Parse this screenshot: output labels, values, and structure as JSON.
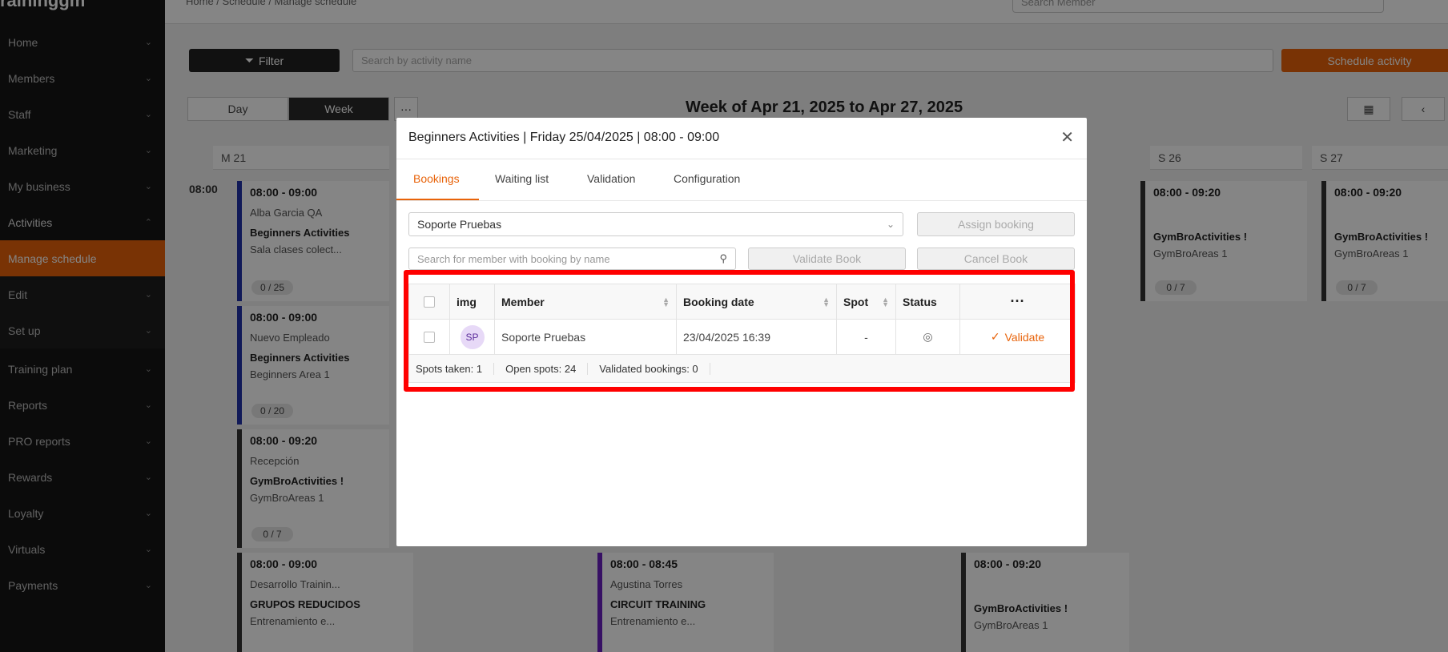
{
  "sidebar": {
    "logo": "raininggm",
    "items": [
      {
        "label": "Home",
        "chev": "⌄"
      },
      {
        "label": "Members",
        "chev": "⌄"
      },
      {
        "label": "Staff",
        "chev": "⌄"
      },
      {
        "label": "Marketing",
        "chev": "⌄"
      },
      {
        "label": "My business",
        "chev": "⌄"
      },
      {
        "label": "Activities",
        "chev": "⌃"
      },
      {
        "label": "Manage schedule",
        "chev": ""
      },
      {
        "label": "Edit",
        "chev": "⌄"
      },
      {
        "label": "Set up",
        "chev": "⌄"
      },
      {
        "label": "Training plan",
        "chev": "⌄"
      },
      {
        "label": "Reports",
        "chev": "⌄"
      },
      {
        "label": "PRO reports",
        "chev": "⌄"
      },
      {
        "label": "Rewards",
        "chev": "⌄"
      },
      {
        "label": "Loyalty",
        "chev": "⌄"
      },
      {
        "label": "Virtuals",
        "chev": "⌄"
      },
      {
        "label": "Payments",
        "chev": "⌄"
      }
    ]
  },
  "header": {
    "breadcrumb": "Home  /  Schedule  /  Manage schedule",
    "search_placeholder": "Search Member"
  },
  "toolbar": {
    "filter_label": "Filter",
    "search_placeholder": "Search by activity name",
    "schedule_label": "Schedule activity",
    "day_label": "Day",
    "week_label": "Week",
    "week_title": "Week of Apr 21, 2025 to Apr 27, 2025"
  },
  "calendar": {
    "columns": [
      "M 21",
      "S 26",
      "S 27"
    ],
    "time": "08:00",
    "cards": [
      {
        "time": "08:00 - 09:00",
        "person": "Alba Garcia QA",
        "name": "Beginners Activities",
        "area": "Sala clases colect...",
        "count": "0 / 25"
      },
      {
        "time": "08:00 - 09:00",
        "person": "Nuevo Empleado",
        "name": "Beginners Activities",
        "area": "Beginners Area 1",
        "count": "0 / 20"
      },
      {
        "time": "08:00 - 09:20",
        "person": "Recepción",
        "name": "GymBroActivities !",
        "area": "GymBroAreas 1",
        "count": "0 / 7"
      },
      {
        "time": "08:00 - 09:00",
        "person": "Desarrollo Trainin...",
        "name": "GRUPOS REDUCIDOS",
        "area": "Entrenamiento e...",
        "count": ""
      },
      {
        "time": "08:00 - 08:45",
        "person": "Agustina Torres",
        "name": "CIRCUIT TRAINING",
        "area": "Entrenamiento e...",
        "count": ""
      },
      {
        "time": "08:00 - 09:20",
        "person": "",
        "name": "GymBroActivities !",
        "area": "GymBroAreas 1",
        "count": ""
      },
      {
        "time": "08:00 - 09:20",
        "person": "",
        "name": "GymBroActivities !",
        "area": "GymBroAreas 1",
        "count": "0 / 7"
      },
      {
        "time": "08:00 - 09:20",
        "person": "",
        "name": "GymBroActivities !",
        "area": "GymBroAreas 1",
        "count": "0 / 7"
      }
    ]
  },
  "modal": {
    "title": "Beginners Activities | Friday 25/04/2025 | 08:00 - 09:00",
    "tabs": [
      "Bookings",
      "Waiting list",
      "Validation",
      "Configuration"
    ],
    "selected_member": "Soporte Pruebas",
    "assign_label": "Assign booking",
    "member_search_placeholder": "Search for member with booking by name",
    "validate_book_label": "Validate Book",
    "cancel_book_label": "Cancel Book",
    "table": {
      "headers": [
        "img",
        "Member",
        "Booking date",
        "Spot",
        "Status",
        "···"
      ],
      "rows": [
        {
          "initials": "SP",
          "member": "Soporte Pruebas",
          "date": "23/04/2025 16:39",
          "spot": "-",
          "action": "Validate"
        }
      ],
      "footer": [
        "Spots taken: 1",
        "Open spots: 24",
        "Validated bookings: 0"
      ]
    }
  },
  "colors": {
    "accent": "#e8630a",
    "highlight": "#ff0000"
  }
}
